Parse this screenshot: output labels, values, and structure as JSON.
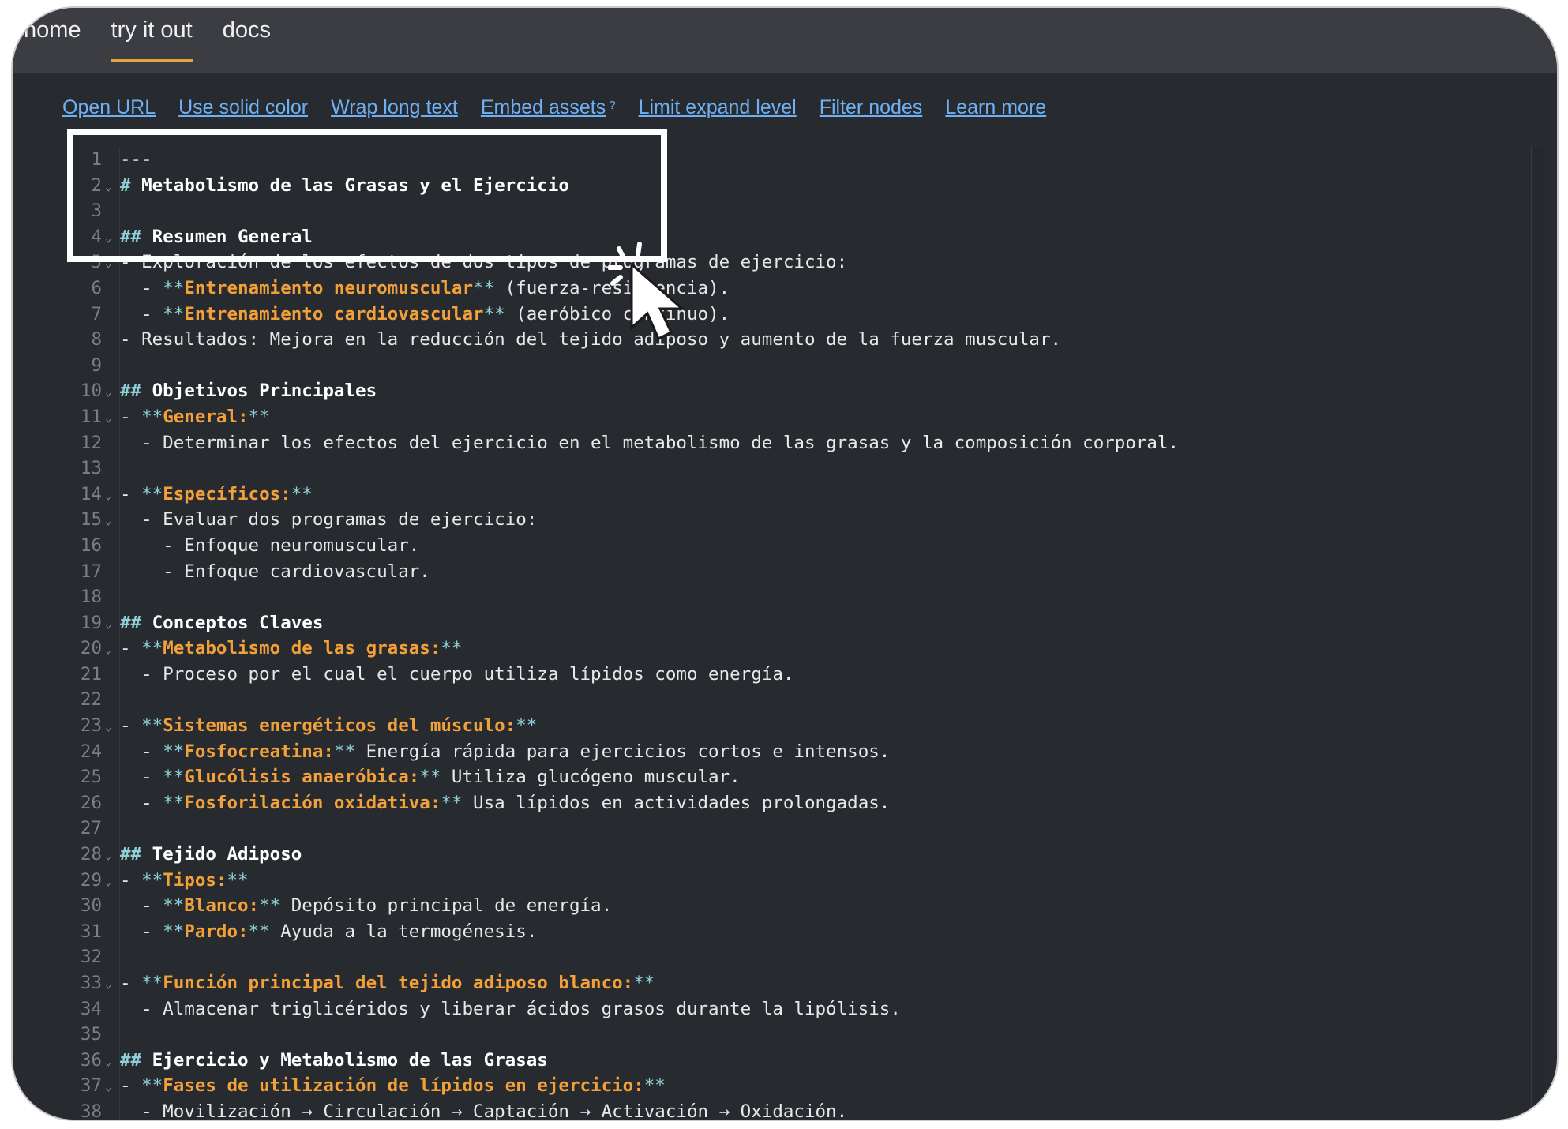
{
  "nav": {
    "items": [
      "home",
      "try it out",
      "docs"
    ],
    "active_index": 1
  },
  "toolbar": {
    "links": [
      "Open URL",
      "Use solid color",
      "Wrap long text",
      "Embed assets",
      "Limit expand level",
      "Filter nodes",
      "Learn more"
    ],
    "embed_superscript": "?"
  },
  "editor": {
    "lines": [
      {
        "n": "1",
        "fold": false,
        "segments": [
          [
            "rule",
            "---"
          ]
        ]
      },
      {
        "n": "2",
        "fold": true,
        "segments": [
          [
            "hm",
            "# "
          ],
          [
            "h",
            "Metabolismo de las Grasas y el Ejercicio"
          ]
        ]
      },
      {
        "n": "3",
        "fold": false,
        "segments": []
      },
      {
        "n": "4",
        "fold": true,
        "segments": [
          [
            "hm",
            "## "
          ],
          [
            "h",
            "Resumen General"
          ]
        ]
      },
      {
        "n": "5",
        "fold": true,
        "segments": [
          [
            "dash",
            "- Exploración de los efectos de dos tipos de programas de ejercicio:"
          ]
        ]
      },
      {
        "n": "6",
        "fold": false,
        "segments": [
          [
            "dash",
            "  - "
          ],
          [
            "ast",
            "**"
          ],
          [
            "key",
            "Entrenamiento neuromuscular"
          ],
          [
            "ast",
            "**"
          ],
          [
            "dash",
            " (fuerza-resistencia)."
          ]
        ]
      },
      {
        "n": "7",
        "fold": false,
        "segments": [
          [
            "dash",
            "  - "
          ],
          [
            "ast",
            "**"
          ],
          [
            "key",
            "Entrenamiento cardiovascular"
          ],
          [
            "ast",
            "**"
          ],
          [
            "dash",
            " (aeróbico continuo)."
          ]
        ]
      },
      {
        "n": "8",
        "fold": false,
        "segments": [
          [
            "dash",
            "- Resultados: Mejora en la reducción del tejido adiposo y aumento de la fuerza muscular."
          ]
        ]
      },
      {
        "n": "9",
        "fold": false,
        "segments": []
      },
      {
        "n": "10",
        "fold": true,
        "segments": [
          [
            "hm",
            "## "
          ],
          [
            "h",
            "Objetivos Principales"
          ]
        ]
      },
      {
        "n": "11",
        "fold": true,
        "segments": [
          [
            "dash",
            "- "
          ],
          [
            "ast",
            "**"
          ],
          [
            "key",
            "General:"
          ],
          [
            "ast",
            "**"
          ]
        ]
      },
      {
        "n": "12",
        "fold": false,
        "segments": [
          [
            "dash",
            "  - Determinar los efectos del ejercicio en el metabolismo de las grasas y la composición corporal."
          ]
        ]
      },
      {
        "n": "13",
        "fold": false,
        "segments": []
      },
      {
        "n": "14",
        "fold": true,
        "segments": [
          [
            "dash",
            "- "
          ],
          [
            "ast",
            "**"
          ],
          [
            "key",
            "Específicos:"
          ],
          [
            "ast",
            "**"
          ]
        ]
      },
      {
        "n": "15",
        "fold": true,
        "segments": [
          [
            "dash",
            "  - Evaluar dos programas de ejercicio:"
          ]
        ]
      },
      {
        "n": "16",
        "fold": false,
        "segments": [
          [
            "dash",
            "    - Enfoque neuromuscular."
          ]
        ]
      },
      {
        "n": "17",
        "fold": false,
        "segments": [
          [
            "dash",
            "    - Enfoque cardiovascular."
          ]
        ]
      },
      {
        "n": "18",
        "fold": false,
        "segments": []
      },
      {
        "n": "19",
        "fold": true,
        "segments": [
          [
            "hm",
            "## "
          ],
          [
            "h",
            "Conceptos Claves"
          ]
        ]
      },
      {
        "n": "20",
        "fold": true,
        "segments": [
          [
            "dash",
            "- "
          ],
          [
            "ast",
            "**"
          ],
          [
            "key",
            "Metabolismo de las grasas:"
          ],
          [
            "ast",
            "**"
          ]
        ]
      },
      {
        "n": "21",
        "fold": false,
        "segments": [
          [
            "dash",
            "  - Proceso por el cual el cuerpo utiliza lípidos como energía."
          ]
        ]
      },
      {
        "n": "22",
        "fold": false,
        "segments": []
      },
      {
        "n": "23",
        "fold": true,
        "segments": [
          [
            "dash",
            "- "
          ],
          [
            "ast",
            "**"
          ],
          [
            "key",
            "Sistemas energéticos del músculo:"
          ],
          [
            "ast",
            "**"
          ]
        ]
      },
      {
        "n": "24",
        "fold": false,
        "segments": [
          [
            "dash",
            "  - "
          ],
          [
            "ast",
            "**"
          ],
          [
            "key",
            "Fosfocreatina:"
          ],
          [
            "ast",
            "**"
          ],
          [
            "dash",
            " Energía rápida para ejercicios cortos e intensos."
          ]
        ]
      },
      {
        "n": "25",
        "fold": false,
        "segments": [
          [
            "dash",
            "  - "
          ],
          [
            "ast",
            "**"
          ],
          [
            "key",
            "Glucólisis anaeróbica:"
          ],
          [
            "ast",
            "**"
          ],
          [
            "dash",
            " Utiliza glucógeno muscular."
          ]
        ]
      },
      {
        "n": "26",
        "fold": false,
        "segments": [
          [
            "dash",
            "  - "
          ],
          [
            "ast",
            "**"
          ],
          [
            "key",
            "Fosforilación oxidativa:"
          ],
          [
            "ast",
            "**"
          ],
          [
            "dash",
            " Usa lípidos en actividades prolongadas."
          ]
        ]
      },
      {
        "n": "27",
        "fold": false,
        "segments": []
      },
      {
        "n": "28",
        "fold": true,
        "segments": [
          [
            "hm",
            "## "
          ],
          [
            "h",
            "Tejido Adiposo"
          ]
        ]
      },
      {
        "n": "29",
        "fold": true,
        "segments": [
          [
            "dash",
            "- "
          ],
          [
            "ast",
            "**"
          ],
          [
            "key",
            "Tipos:"
          ],
          [
            "ast",
            "**"
          ]
        ]
      },
      {
        "n": "30",
        "fold": false,
        "segments": [
          [
            "dash",
            "  - "
          ],
          [
            "ast",
            "**"
          ],
          [
            "key",
            "Blanco:"
          ],
          [
            "ast",
            "**"
          ],
          [
            "dash",
            " Depósito principal de energía."
          ]
        ]
      },
      {
        "n": "31",
        "fold": false,
        "segments": [
          [
            "dash",
            "  - "
          ],
          [
            "ast",
            "**"
          ],
          [
            "key",
            "Pardo:"
          ],
          [
            "ast",
            "**"
          ],
          [
            "dash",
            " Ayuda a la termogénesis."
          ]
        ]
      },
      {
        "n": "32",
        "fold": false,
        "segments": []
      },
      {
        "n": "33",
        "fold": true,
        "segments": [
          [
            "dash",
            "- "
          ],
          [
            "ast",
            "**"
          ],
          [
            "key",
            "Función principal del tejido adiposo blanco:"
          ],
          [
            "ast",
            "**"
          ]
        ]
      },
      {
        "n": "34",
        "fold": false,
        "segments": [
          [
            "dash",
            "  - Almacenar triglicéridos y liberar ácidos grasos durante la lipólisis."
          ]
        ]
      },
      {
        "n": "35",
        "fold": false,
        "segments": []
      },
      {
        "n": "36",
        "fold": true,
        "segments": [
          [
            "hm",
            "## "
          ],
          [
            "h",
            "Ejercicio y Metabolismo de las Grasas"
          ]
        ]
      },
      {
        "n": "37",
        "fold": true,
        "segments": [
          [
            "dash",
            "- "
          ],
          [
            "ast",
            "**"
          ],
          [
            "key",
            "Fases de utilización de lípidos en ejercicio:"
          ],
          [
            "ast",
            "**"
          ]
        ]
      },
      {
        "n": "38",
        "fold": false,
        "segments": [
          [
            "dash",
            "  - Movilización → Circulación → Captación → Activación → Oxidación."
          ]
        ]
      }
    ]
  },
  "colors": {
    "accent": "#e0a340",
    "link": "#6fb0f4",
    "keyword": "#f2a03a",
    "markdown_marker": "#8fd0d8",
    "background": "#272a2f"
  }
}
